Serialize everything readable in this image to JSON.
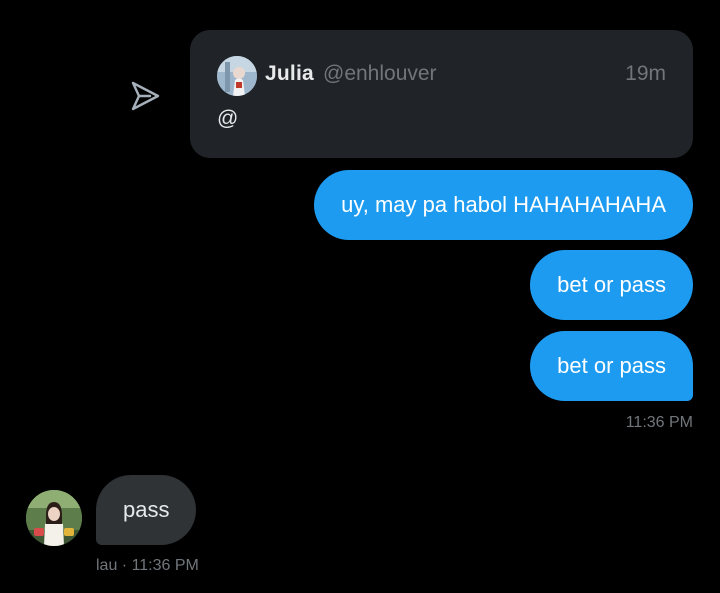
{
  "quote": {
    "name": "Julia",
    "handle": "@enhlouver",
    "time": "19m",
    "text": "@"
  },
  "outgoing": {
    "messages": [
      "uy, may pa habol HAHAHAHAHA",
      "bet or pass",
      "bet or pass"
    ],
    "time": "11:36 PM"
  },
  "incoming": {
    "message": "pass",
    "meta": "lau · 11:36 PM"
  },
  "colors": {
    "background": "#000000",
    "outgoing_bubble": "#1d9bf0",
    "incoming_bubble": "#2f3336",
    "card": "#202327",
    "muted_text": "#71767b"
  },
  "icons": {
    "share": "share-icon"
  }
}
